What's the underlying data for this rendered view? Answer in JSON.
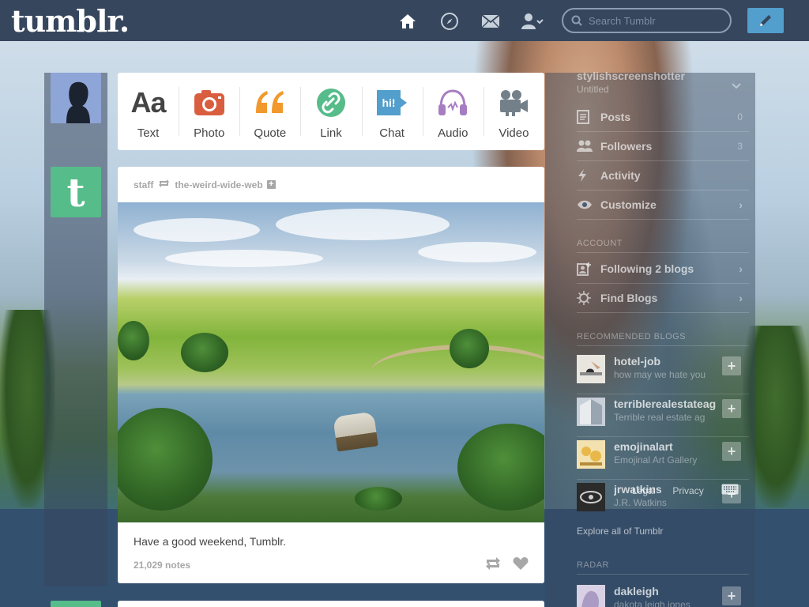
{
  "header": {
    "logo": "tumblr.",
    "nav_icons": [
      "home-icon",
      "explore-compass-icon",
      "inbox-mail-icon",
      "account-user-icon"
    ],
    "search_placeholder": "Search Tumblr",
    "compose_icon": "pencil-icon",
    "accent": "#529ecc",
    "bar_color": "#36465d"
  },
  "composer": {
    "types": [
      {
        "label": "Text",
        "icon": "text-icon",
        "glyph": "Aa",
        "color": "#444444"
      },
      {
        "label": "Photo",
        "icon": "camera-icon",
        "color": "#d95e40"
      },
      {
        "label": "Quote",
        "icon": "quote-icon",
        "glyph": "66",
        "color": "#f2992e"
      },
      {
        "label": "Link",
        "icon": "link-icon",
        "color": "#56bc8a"
      },
      {
        "label": "Chat",
        "icon": "chat-icon",
        "glyph": "hi!",
        "color": "#529ecc"
      },
      {
        "label": "Audio",
        "icon": "headphones-icon",
        "color": "#a77dc2"
      },
      {
        "label": "Video",
        "icon": "video-camera-icon",
        "color": "#748089"
      }
    ]
  },
  "post": {
    "author": "staff",
    "reblogged_from": "the-weird-wide-web",
    "caption": "Have a good weekend, Tumblr.",
    "notes": "21,029 notes"
  },
  "sidebar": {
    "blog_name": "stylishscreenshotter",
    "blog_title": "Untitled",
    "menu": [
      {
        "label": "Posts",
        "icon": "posts-icon",
        "count": "0"
      },
      {
        "label": "Followers",
        "icon": "followers-icon",
        "count": "3"
      },
      {
        "label": "Activity",
        "icon": "activity-bolt-icon",
        "count": ""
      },
      {
        "label": "Customize",
        "icon": "eye-icon",
        "count": "",
        "arrow": "›"
      }
    ],
    "account_heading": "ACCOUNT",
    "account_items": [
      {
        "label": "Following 2 blogs",
        "icon": "following-icon",
        "arrow": "›"
      },
      {
        "label": "Find Blogs",
        "icon": "find-blogs-icon",
        "arrow": "›"
      }
    ],
    "recommended_heading": "RECOMMENDED BLOGS",
    "recommended": [
      {
        "name": "hotel-job",
        "desc": "how may we hate you",
        "avatar_color": "#e9e6e0"
      },
      {
        "name": "terriblerealestateag",
        "desc": "Terrible real estate ag",
        "avatar_color": "#c7cfd9"
      },
      {
        "name": "emojinalart",
        "desc": "Emojinal Art Gallery",
        "avatar_color": "#e8c873"
      },
      {
        "name": "jrwatkins",
        "desc": "J.R. Watkins",
        "avatar_color": "#2b2b2b"
      }
    ],
    "overlay_links": {
      "legal": "Legal",
      "privacy": "Privacy"
    },
    "explore_link": "Explore all of Tumblr",
    "radar_heading": "RADAR",
    "radar": {
      "name": "dakleigh",
      "desc": "dakota leigh jones",
      "avatar_color": "#c9c0d8"
    },
    "follow_glyph": "+"
  }
}
